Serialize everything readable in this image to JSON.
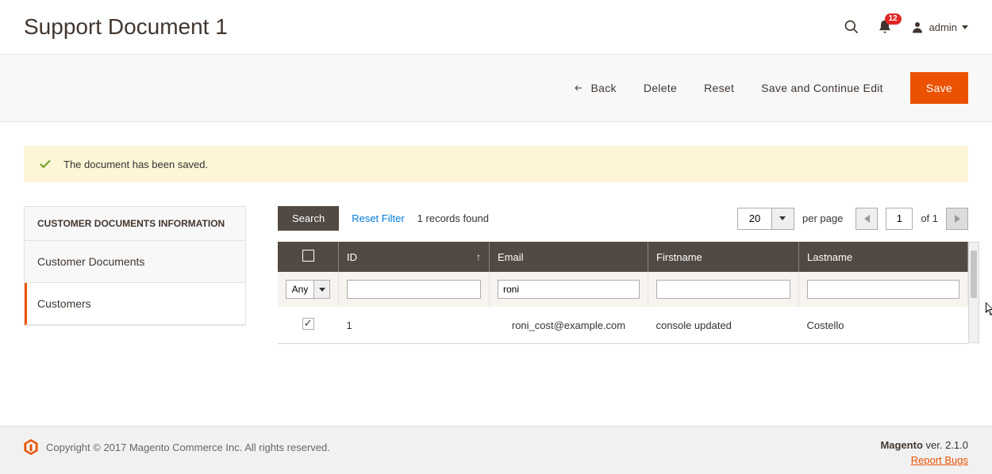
{
  "header": {
    "title": "Support Document 1",
    "notification_count": "12",
    "user_name": "admin"
  },
  "actions": {
    "back": "Back",
    "delete": "Delete",
    "reset": "Reset",
    "save_continue": "Save and Continue Edit",
    "save": "Save"
  },
  "message": {
    "text": "The document has been saved."
  },
  "sidebar": {
    "title": "CUSTOMER DOCUMENTS INFORMATION",
    "items": [
      {
        "label": "Customer Documents"
      },
      {
        "label": "Customers"
      }
    ]
  },
  "grid": {
    "search_btn": "Search",
    "reset_filter": "Reset Filter",
    "records_found": "1 records found",
    "per_page_value": "20",
    "per_page_label": "per page",
    "page_value": "1",
    "page_total_label": "of 1",
    "any_label": "Any",
    "email_filter": "roni",
    "columns": {
      "id": "ID",
      "email": "Email",
      "firstname": "Firstname",
      "lastname": "Lastname"
    },
    "rows": [
      {
        "id": "1",
        "email": "roni_cost@example.com",
        "firstname": "console updated",
        "lastname": "Costello"
      }
    ]
  },
  "footer": {
    "copyright": "Copyright © 2017 Magento Commerce Inc. All rights reserved.",
    "brand": "Magento",
    "version": " ver. 2.1.0",
    "report_bugs": "Report Bugs"
  }
}
